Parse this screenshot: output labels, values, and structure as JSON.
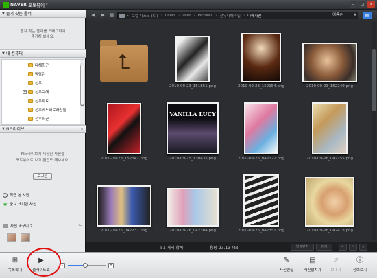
{
  "title": {
    "brand": "NAVER",
    "app_name": "포토뷰어"
  },
  "left": {
    "favorites_header": "즐겨 찾는 폴더",
    "favorites_hint_1": "즐겨 찾는 폴더를 드래그하여",
    "favorites_hint_2": "추가해 보세요.",
    "mycomputer_header": "내 컴퓨터",
    "tree_items": [
      {
        "label": "다해최근",
        "expander": ""
      },
      {
        "label": "박람린",
        "expander": ""
      },
      {
        "label": "선우",
        "expander": ""
      },
      {
        "label": "선우다해",
        "expander": "+"
      },
      {
        "label": "선우자료",
        "expander": ""
      },
      {
        "label": "선우와도자료사진들",
        "expander": ""
      },
      {
        "label": "선우최근",
        "expander": ""
      }
    ],
    "ndrive_header": "N드라이브",
    "ndrive_hint_1": "N드라이브에 저장된 사진을",
    "ndrive_hint_2": "포토뷰어로 보고 편집도 해보세요!",
    "login": "로그인",
    "recent": "최근 본 사진",
    "important": "중요 표시한 사진",
    "basket": "사진 바구니 2"
  },
  "path": {
    "crumbs": [
      "로컬 디스크 (C:)",
      "Users",
      "user",
      "Pictures",
      "선우다해파일",
      "다해사진"
    ],
    "sort": "이름순"
  },
  "grid": [
    {
      "caption": "",
      "kind": "up"
    },
    {
      "caption": "2010-09-23_151851.png",
      "kind": "bw"
    },
    {
      "caption": "2010-09-23_152154.png",
      "kind": "stage"
    },
    {
      "caption": "2010-09-23_152249.png",
      "kind": "face"
    },
    {
      "caption": "2010-09-23_152342.png",
      "kind": "red"
    },
    {
      "caption": "2010-09-25_130435.png",
      "kind": "vanilla"
    },
    {
      "caption": "2010-09-26_042122.png",
      "kind": "girl"
    },
    {
      "caption": "2010-09-26_042155.png",
      "kind": "blonde"
    },
    {
      "caption": "2010-09-26_042237.png",
      "kind": "group"
    },
    {
      "caption": "2010-09-26_042304.png",
      "kind": "group2"
    },
    {
      "caption": "2010-09-26_042351.png",
      "kind": "stripe"
    },
    {
      "caption": "2010-09-26_042418.png",
      "kind": "closeup"
    }
  ],
  "vanilla_text": "VANILLA LUCY",
  "status": {
    "count": "51 개의 항목",
    "capacity": "용량 23.13 MB",
    "btn1": "일괄변환",
    "btn2": "닫기"
  },
  "toolbar": {
    "fit": "목록확대",
    "slideshow": "슬라이드쇼",
    "edit": "사진편집",
    "merge": "사진합치기",
    "share": "보내기",
    "info": "정보보기"
  },
  "zoom_level": 0.45,
  "colors": {
    "accent": "#3a7fe0",
    "annotation": "#e01010"
  }
}
